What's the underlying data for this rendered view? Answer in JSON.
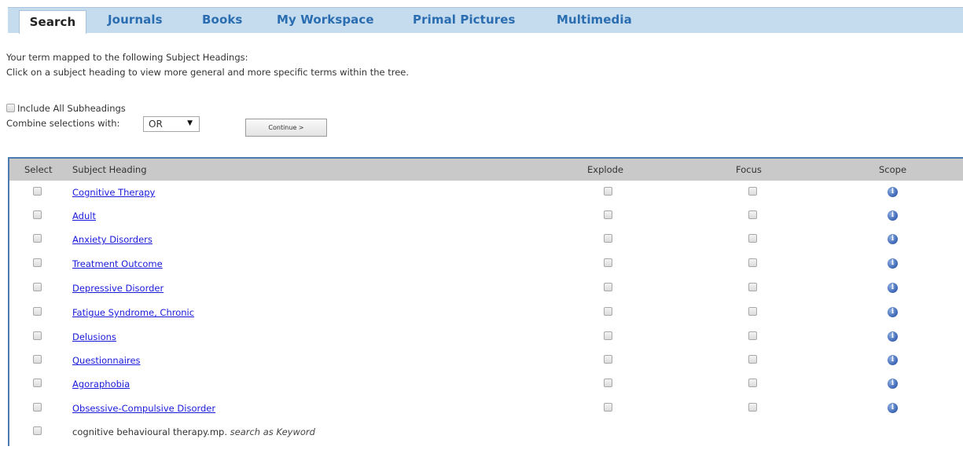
{
  "tabs": [
    {
      "label": "Search",
      "active": true
    },
    {
      "label": "Journals"
    },
    {
      "label": "Books"
    },
    {
      "label": "My Workspace"
    },
    {
      "label": "Primal Pictures"
    },
    {
      "label": "Multimedia"
    }
  ],
  "intro": {
    "line1": "Your term mapped to the following Subject Headings:",
    "line2": "Click on a subject heading to view more general and more specific terms within the tree."
  },
  "options": {
    "include_subheadings_label": "Include All Subheadings",
    "combine_label": "Combine selections with:",
    "combine_value": "OR",
    "continue_label": "Continue >"
  },
  "table": {
    "headers": {
      "select": "Select",
      "subject": "Subject Heading",
      "explode": "Explode",
      "focus": "Focus",
      "scope": "Scope"
    },
    "rows": [
      "Cognitive Therapy",
      "Adult",
      "Anxiety Disorders",
      "Treatment Outcome",
      "Depressive Disorder",
      "Fatigue Syndrome, Chronic",
      "Delusions",
      "Questionnaires",
      "Agoraphobia",
      "Obsessive-Compulsive Disorder"
    ],
    "keyword_row": {
      "term": "cognitive behavioural therapy.mp.",
      "suffix": "search as Keyword"
    }
  },
  "icons": {
    "scope": "info-icon",
    "checkbox": "checkbox-unchecked"
  },
  "colors": {
    "tab_bar": "#c5dbee",
    "tab_text": "#2a6db0",
    "link": "#1a1adb",
    "header_bg": "#c9c9c9",
    "table_border": "#4a7bb0"
  }
}
